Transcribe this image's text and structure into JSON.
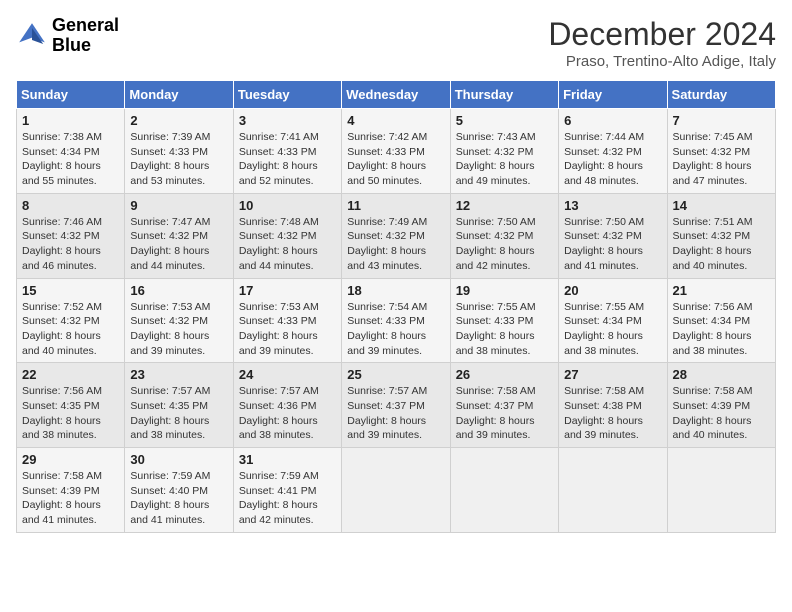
{
  "logo": {
    "line1": "General",
    "line2": "Blue"
  },
  "title": "December 2024",
  "subtitle": "Praso, Trentino-Alto Adige, Italy",
  "weekdays": [
    "Sunday",
    "Monday",
    "Tuesday",
    "Wednesday",
    "Thursday",
    "Friday",
    "Saturday"
  ],
  "weeks": [
    [
      {
        "day": "1",
        "sunrise": "Sunrise: 7:38 AM",
        "sunset": "Sunset: 4:34 PM",
        "daylight": "Daylight: 8 hours and 55 minutes."
      },
      {
        "day": "2",
        "sunrise": "Sunrise: 7:39 AM",
        "sunset": "Sunset: 4:33 PM",
        "daylight": "Daylight: 8 hours and 53 minutes."
      },
      {
        "day": "3",
        "sunrise": "Sunrise: 7:41 AM",
        "sunset": "Sunset: 4:33 PM",
        "daylight": "Daylight: 8 hours and 52 minutes."
      },
      {
        "day": "4",
        "sunrise": "Sunrise: 7:42 AM",
        "sunset": "Sunset: 4:33 PM",
        "daylight": "Daylight: 8 hours and 50 minutes."
      },
      {
        "day": "5",
        "sunrise": "Sunrise: 7:43 AM",
        "sunset": "Sunset: 4:32 PM",
        "daylight": "Daylight: 8 hours and 49 minutes."
      },
      {
        "day": "6",
        "sunrise": "Sunrise: 7:44 AM",
        "sunset": "Sunset: 4:32 PM",
        "daylight": "Daylight: 8 hours and 48 minutes."
      },
      {
        "day": "7",
        "sunrise": "Sunrise: 7:45 AM",
        "sunset": "Sunset: 4:32 PM",
        "daylight": "Daylight: 8 hours and 47 minutes."
      }
    ],
    [
      {
        "day": "8",
        "sunrise": "Sunrise: 7:46 AM",
        "sunset": "Sunset: 4:32 PM",
        "daylight": "Daylight: 8 hours and 46 minutes."
      },
      {
        "day": "9",
        "sunrise": "Sunrise: 7:47 AM",
        "sunset": "Sunset: 4:32 PM",
        "daylight": "Daylight: 8 hours and 44 minutes."
      },
      {
        "day": "10",
        "sunrise": "Sunrise: 7:48 AM",
        "sunset": "Sunset: 4:32 PM",
        "daylight": "Daylight: 8 hours and 44 minutes."
      },
      {
        "day": "11",
        "sunrise": "Sunrise: 7:49 AM",
        "sunset": "Sunset: 4:32 PM",
        "daylight": "Daylight: 8 hours and 43 minutes."
      },
      {
        "day": "12",
        "sunrise": "Sunrise: 7:50 AM",
        "sunset": "Sunset: 4:32 PM",
        "daylight": "Daylight: 8 hours and 42 minutes."
      },
      {
        "day": "13",
        "sunrise": "Sunrise: 7:50 AM",
        "sunset": "Sunset: 4:32 PM",
        "daylight": "Daylight: 8 hours and 41 minutes."
      },
      {
        "day": "14",
        "sunrise": "Sunrise: 7:51 AM",
        "sunset": "Sunset: 4:32 PM",
        "daylight": "Daylight: 8 hours and 40 minutes."
      }
    ],
    [
      {
        "day": "15",
        "sunrise": "Sunrise: 7:52 AM",
        "sunset": "Sunset: 4:32 PM",
        "daylight": "Daylight: 8 hours and 40 minutes."
      },
      {
        "day": "16",
        "sunrise": "Sunrise: 7:53 AM",
        "sunset": "Sunset: 4:32 PM",
        "daylight": "Daylight: 8 hours and 39 minutes."
      },
      {
        "day": "17",
        "sunrise": "Sunrise: 7:53 AM",
        "sunset": "Sunset: 4:33 PM",
        "daylight": "Daylight: 8 hours and 39 minutes."
      },
      {
        "day": "18",
        "sunrise": "Sunrise: 7:54 AM",
        "sunset": "Sunset: 4:33 PM",
        "daylight": "Daylight: 8 hours and 39 minutes."
      },
      {
        "day": "19",
        "sunrise": "Sunrise: 7:55 AM",
        "sunset": "Sunset: 4:33 PM",
        "daylight": "Daylight: 8 hours and 38 minutes."
      },
      {
        "day": "20",
        "sunrise": "Sunrise: 7:55 AM",
        "sunset": "Sunset: 4:34 PM",
        "daylight": "Daylight: 8 hours and 38 minutes."
      },
      {
        "day": "21",
        "sunrise": "Sunrise: 7:56 AM",
        "sunset": "Sunset: 4:34 PM",
        "daylight": "Daylight: 8 hours and 38 minutes."
      }
    ],
    [
      {
        "day": "22",
        "sunrise": "Sunrise: 7:56 AM",
        "sunset": "Sunset: 4:35 PM",
        "daylight": "Daylight: 8 hours and 38 minutes."
      },
      {
        "day": "23",
        "sunrise": "Sunrise: 7:57 AM",
        "sunset": "Sunset: 4:35 PM",
        "daylight": "Daylight: 8 hours and 38 minutes."
      },
      {
        "day": "24",
        "sunrise": "Sunrise: 7:57 AM",
        "sunset": "Sunset: 4:36 PM",
        "daylight": "Daylight: 8 hours and 38 minutes."
      },
      {
        "day": "25",
        "sunrise": "Sunrise: 7:57 AM",
        "sunset": "Sunset: 4:37 PM",
        "daylight": "Daylight: 8 hours and 39 minutes."
      },
      {
        "day": "26",
        "sunrise": "Sunrise: 7:58 AM",
        "sunset": "Sunset: 4:37 PM",
        "daylight": "Daylight: 8 hours and 39 minutes."
      },
      {
        "day": "27",
        "sunrise": "Sunrise: 7:58 AM",
        "sunset": "Sunset: 4:38 PM",
        "daylight": "Daylight: 8 hours and 39 minutes."
      },
      {
        "day": "28",
        "sunrise": "Sunrise: 7:58 AM",
        "sunset": "Sunset: 4:39 PM",
        "daylight": "Daylight: 8 hours and 40 minutes."
      }
    ],
    [
      {
        "day": "29",
        "sunrise": "Sunrise: 7:58 AM",
        "sunset": "Sunset: 4:39 PM",
        "daylight": "Daylight: 8 hours and 41 minutes."
      },
      {
        "day": "30",
        "sunrise": "Sunrise: 7:59 AM",
        "sunset": "Sunset: 4:40 PM",
        "daylight": "Daylight: 8 hours and 41 minutes."
      },
      {
        "day": "31",
        "sunrise": "Sunrise: 7:59 AM",
        "sunset": "Sunset: 4:41 PM",
        "daylight": "Daylight: 8 hours and 42 minutes."
      },
      null,
      null,
      null,
      null
    ]
  ]
}
